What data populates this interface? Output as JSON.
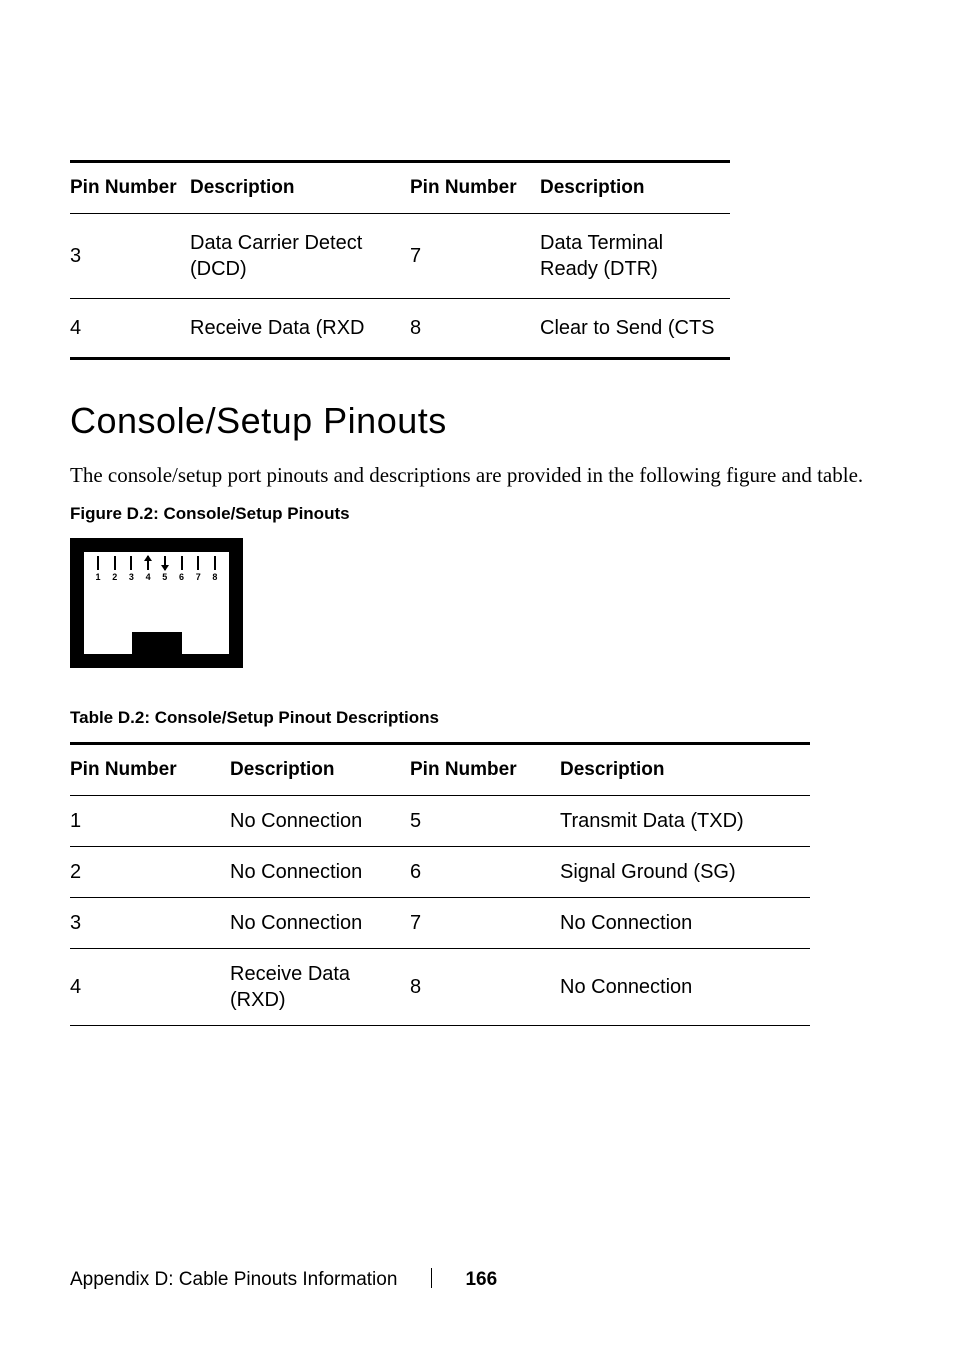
{
  "table1": {
    "headers": {
      "pin_number_a": "Pin Number",
      "description_a": "Description",
      "pin_number_b": "Pin Number",
      "description_b": "Description"
    },
    "rows": [
      {
        "pin_a": "3",
        "desc_a": "Data Carrier Detect (DCD)",
        "pin_b": "7",
        "desc_b": "Data Terminal Ready (DTR)"
      },
      {
        "pin_a": "4",
        "desc_a": "Receive Data (RXD",
        "pin_b": "8",
        "desc_b": "Clear to Send (CTS"
      }
    ]
  },
  "section": {
    "heading": "Console/Setup Pinouts",
    "intro": "The console/setup port pinouts and descriptions are provided in the following figure and table.",
    "figure_caption": "Figure D.2: Console/Setup Pinouts",
    "table_caption": "Table D.2: Console/Setup Pinout Descriptions"
  },
  "figure": {
    "pins": [
      "1",
      "2",
      "3",
      "4",
      "5",
      "6",
      "7",
      "8"
    ]
  },
  "table2": {
    "headers": {
      "pin_number_a": "Pin Number",
      "description_a": "Description",
      "pin_number_b": "Pin Number",
      "description_b": "Description"
    },
    "rows": [
      {
        "pin_a": "1",
        "desc_a": "No Connection",
        "pin_b": "5",
        "desc_b": "Transmit Data (TXD)"
      },
      {
        "pin_a": "2",
        "desc_a": "No Connection",
        "pin_b": "6",
        "desc_b": "Signal Ground (SG)"
      },
      {
        "pin_a": "3",
        "desc_a": "No Connection",
        "pin_b": "7",
        "desc_b": "No Connection"
      },
      {
        "pin_a": "4",
        "desc_a": "Receive Data (RXD)",
        "pin_b": "8",
        "desc_b": "No Connection"
      }
    ]
  },
  "footer": {
    "appendix": "Appendix D: Cable Pinouts Information",
    "page": "166"
  }
}
